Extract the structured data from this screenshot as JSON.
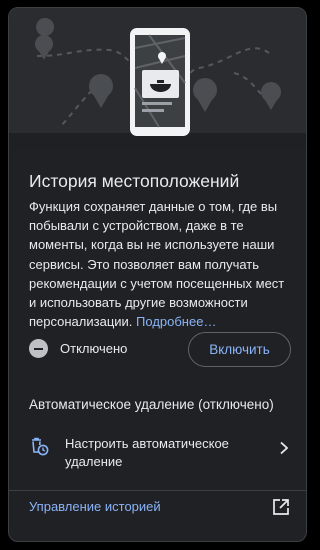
{
  "title": "История местоположений",
  "description": "Функция сохраняет данные о том, где вы побывали с устройством, даже в те моменты, когда вы не используете наши сервисы. Это позволяет вам получать рекомендации с учетом посещенных мест и использовать другие возможности персонализации.",
  "more_link": "Подробнее…",
  "status": {
    "label": "Отключено",
    "icon": "disabled-icon"
  },
  "enable_button": "Включить",
  "auto_delete": {
    "title": "Автоматическое удаление (отключено)",
    "action": "Настроить автоматическое удаление",
    "icon": "auto-delete-icon"
  },
  "manage_history": "Управление историей",
  "colors": {
    "background": "#202124",
    "accent": "#8ab4f8",
    "text": "#e8eaed"
  }
}
